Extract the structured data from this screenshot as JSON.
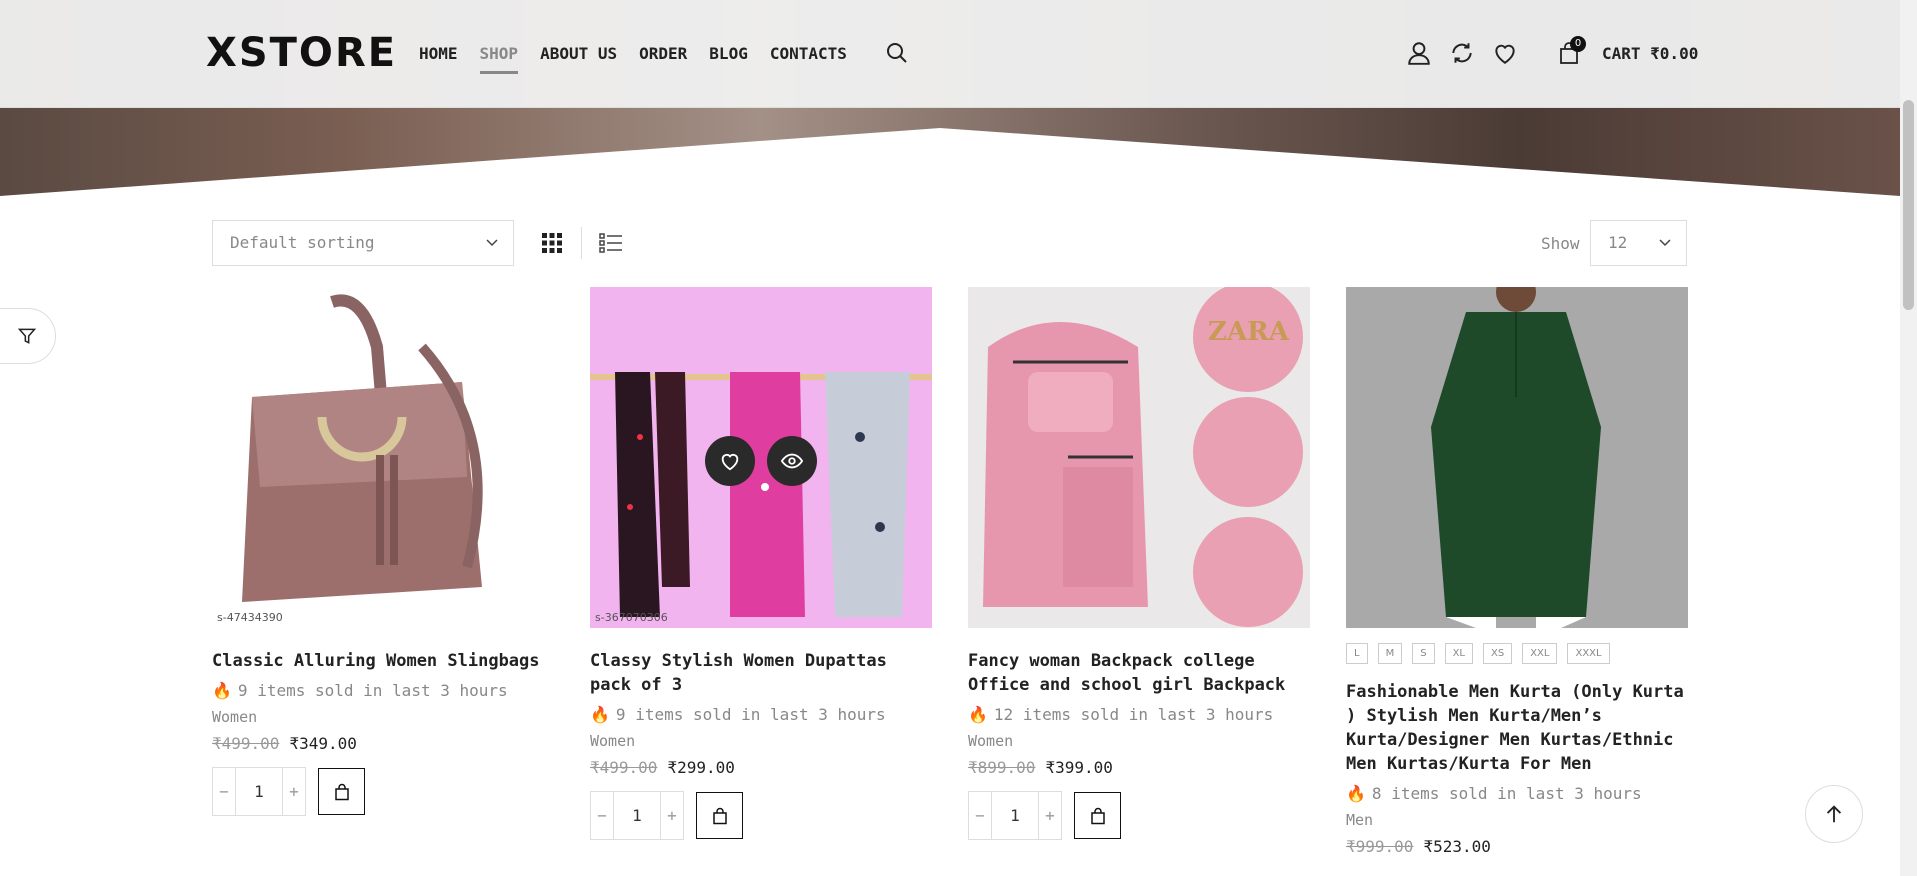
{
  "brand": {
    "logo": "XSTORE"
  },
  "nav": {
    "items": [
      "HOME",
      "SHOP",
      "ABOUT US",
      "ORDER",
      "BLOG",
      "CONTACTS"
    ],
    "active": "SHOP"
  },
  "header": {
    "cart_label": "CART ₹0.00",
    "cart_count": "0"
  },
  "toolbar": {
    "sort_value": "Default sorting",
    "show_label": "Show",
    "per_page": "12"
  },
  "products": [
    {
      "title": "Classic Alluring Women Slingbags",
      "code": "s-47434390",
      "sold": "9 items sold in last 3 hours",
      "category": "Women",
      "old_price": "₹499.00",
      "price": "₹349.00",
      "qty": "1"
    },
    {
      "title": "Classy Stylish Women Dupattas pack of 3",
      "code": "s-367070306",
      "sold": "9 items sold in last 3 hours",
      "category": "Women",
      "old_price": "₹499.00",
      "price": "₹299.00",
      "qty": "1"
    },
    {
      "title": "Fancy woman Backpack college Office and school girl Backpack",
      "sold": "12 items sold in last 3 hours",
      "category": "Women",
      "old_price": "₹899.00",
      "price": "₹399.00",
      "qty": "1",
      "image_text": "ZARA"
    },
    {
      "title": "Fashionable Men Kurta (Only Kurta ) Stylish Men Kurta/Men’s Kurta/Designer Men Kurtas/Ethnic Men Kurtas/Kurta For Men",
      "sold": "8 items sold in last 3 hours",
      "category": "Men",
      "old_price": "₹999.00",
      "price": "₹523.00",
      "sizes": [
        "L",
        "M",
        "S",
        "XL",
        "XS",
        "XXL",
        "XXXL"
      ]
    }
  ],
  "colors": {
    "accent": "#111111",
    "muted": "#888888",
    "fire": "#f0b400"
  }
}
